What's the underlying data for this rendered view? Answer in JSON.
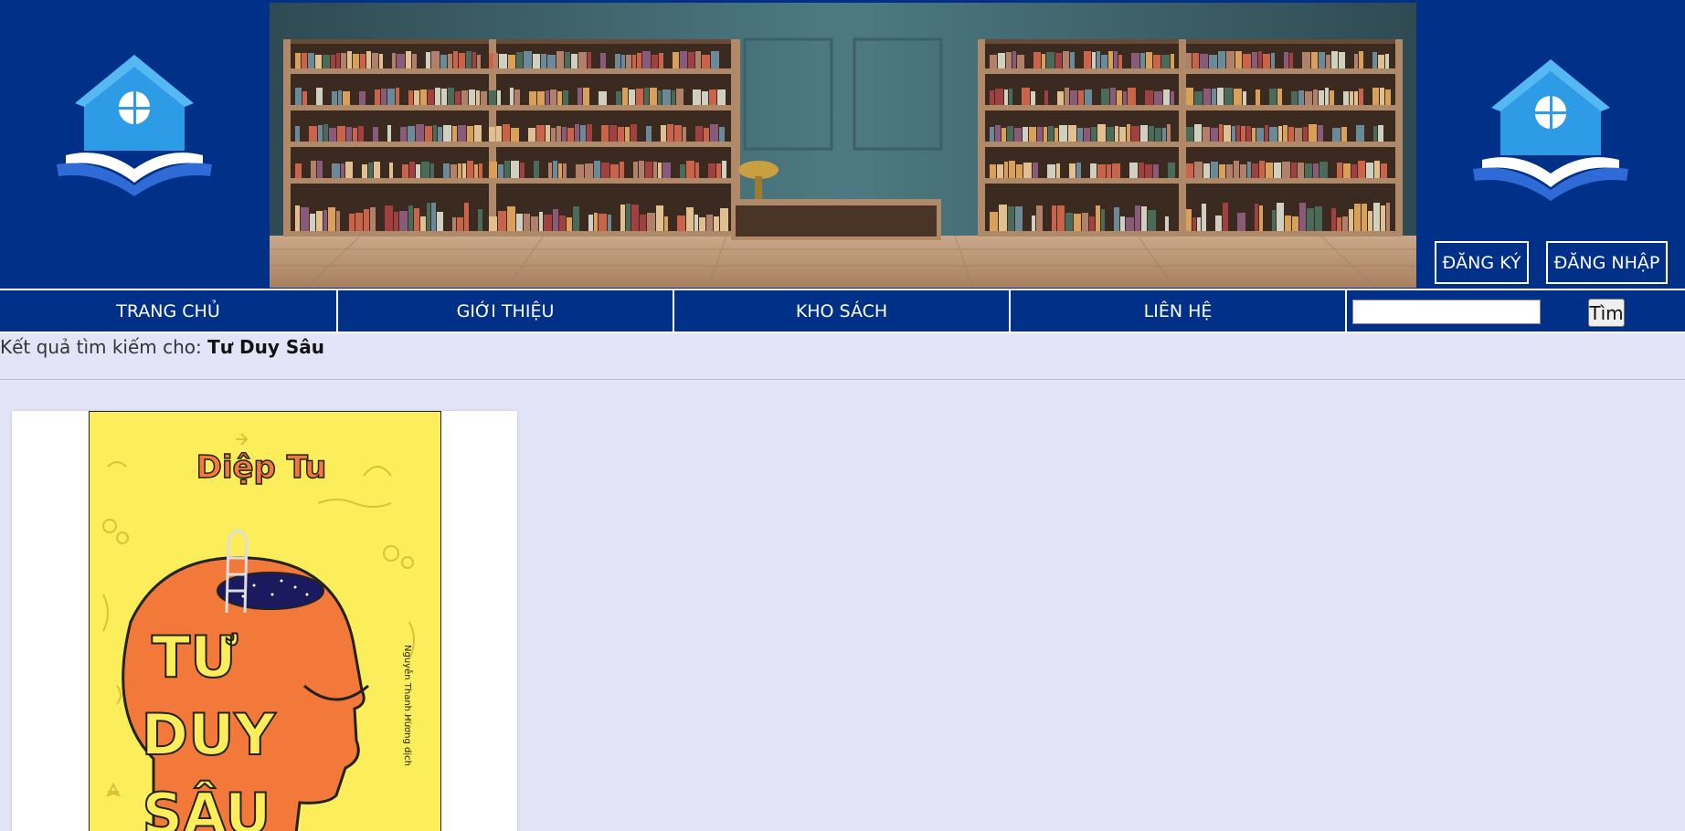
{
  "header": {
    "register_label": "ĐĂNG KÝ",
    "login_label": "ĐĂNG NHẬP"
  },
  "nav": {
    "items": [
      {
        "label": "TRANG CHỦ"
      },
      {
        "label": "GIỚI THIỆU"
      },
      {
        "label": "KHO SÁCH"
      },
      {
        "label": "LIÊN HỆ"
      }
    ],
    "search_value": "",
    "search_button_label": "Tìm"
  },
  "results": {
    "prefix": "Kết quả tìm kiếm cho:",
    "query": "Tư Duy Sâu"
  },
  "book": {
    "cover_author": "Diệp Tu",
    "cover_title_line1": "TƯ",
    "cover_title_line2": "DUY",
    "cover_title_line3": "SÂU",
    "cover_translator": "Nguyễn Thanh Hương dịch"
  },
  "colors": {
    "header_bg": "#003087",
    "page_bg": "#e4e4f8",
    "cover_bg": "#fbee5a",
    "cover_head": "#f2793a",
    "logo_blue": "#2e9be6"
  }
}
